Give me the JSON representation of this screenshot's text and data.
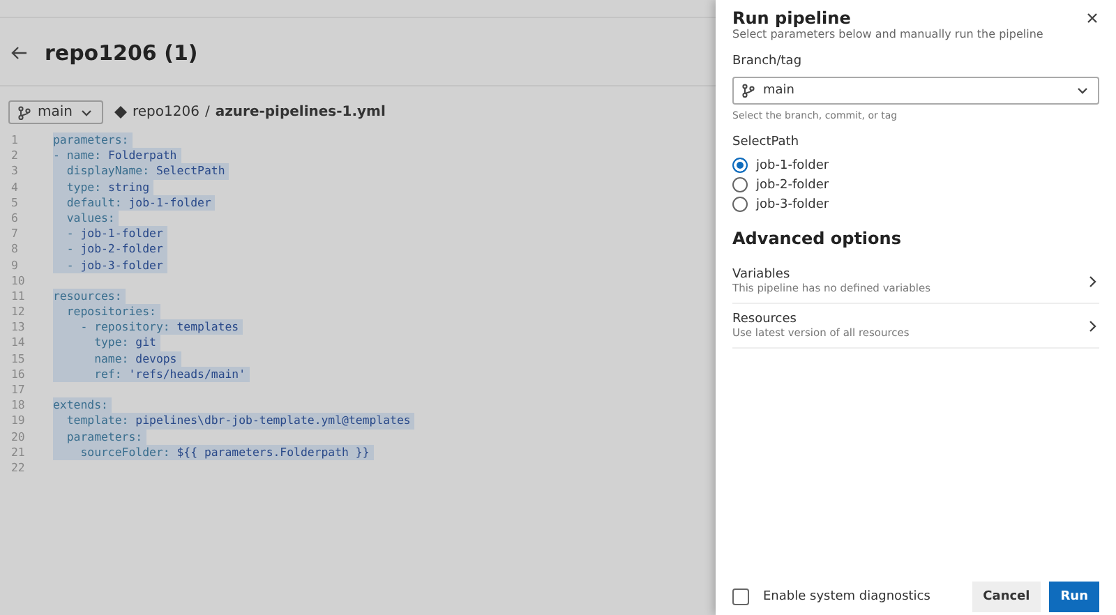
{
  "page": {
    "title": "repo1206 (1)",
    "branch": "main",
    "repo": "repo1206",
    "separator": "/",
    "file": "azure-pipelines-1.yml"
  },
  "code": [
    {
      "number": "1",
      "key": "parameters:"
    },
    {
      "number": "2",
      "key": "- name: ",
      "value": "Folderpath"
    },
    {
      "number": "3",
      "key": "  displayName: ",
      "value": "SelectPath"
    },
    {
      "number": "4",
      "key": "  type: ",
      "value": "string"
    },
    {
      "number": "5",
      "key": "  default: ",
      "value": "job-1-folder"
    },
    {
      "number": "6",
      "key": "  values:"
    },
    {
      "number": "7",
      "key": "  - ",
      "value": "job-1-folder"
    },
    {
      "number": "8",
      "key": "  - ",
      "value": "job-2-folder"
    },
    {
      "number": "9",
      "key": "  - ",
      "value": "job-3-folder"
    },
    {
      "number": "10"
    },
    {
      "number": "11",
      "key": "resources:"
    },
    {
      "number": "12",
      "key": "  repositories:"
    },
    {
      "number": "13",
      "key": "    - repository: ",
      "value": "templates"
    },
    {
      "number": "14",
      "key": "      type: ",
      "value": "git"
    },
    {
      "number": "15",
      "key": "      name: ",
      "value": "devops"
    },
    {
      "number": "16",
      "key": "      ref: ",
      "value": "'refs/heads/main'"
    },
    {
      "number": "17"
    },
    {
      "number": "18",
      "key": "extends:"
    },
    {
      "number": "19",
      "key": "  template: ",
      "value": "pipelines\\dbr-job-template.yml@templates"
    },
    {
      "number": "20",
      "key": "  parameters:"
    },
    {
      "number": "21",
      "key": "    sourceFolder: ",
      "value": "${{ parameters.Folderpath }}"
    },
    {
      "number": "22"
    }
  ],
  "panel": {
    "title": "Run pipeline",
    "subtitle": "Select parameters below and manually run the pipeline",
    "branch_label": "Branch/tag",
    "branch_value": "main",
    "branch_hint": "Select the branch, commit, or tag",
    "param_label": "SelectPath",
    "options": [
      {
        "label": "job-1-folder",
        "selected": true
      },
      {
        "label": "job-2-folder",
        "selected": false
      },
      {
        "label": "job-3-folder",
        "selected": false
      }
    ],
    "advanced_title": "Advanced options",
    "sections": [
      {
        "title": "Variables",
        "description": "This pipeline has no defined variables"
      },
      {
        "title": "Resources",
        "description": "Use latest version of all resources"
      }
    ],
    "diagnostics": {
      "label": "Enable system diagnostics",
      "checked": false
    },
    "buttons": {
      "cancel": "Cancel",
      "run": "Run"
    }
  }
}
